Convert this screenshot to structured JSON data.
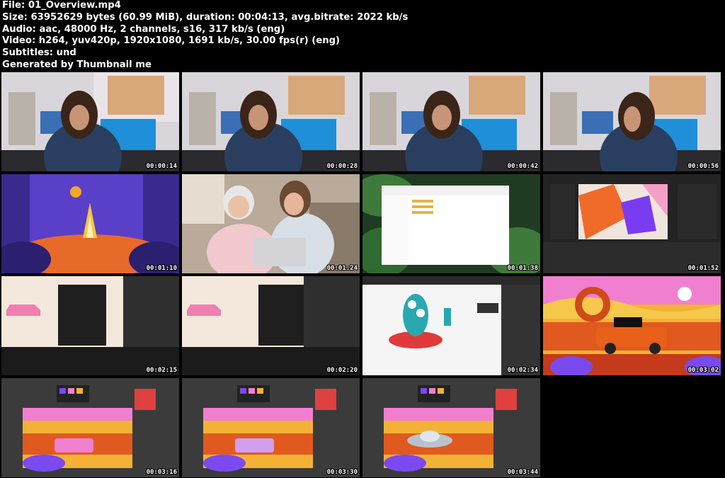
{
  "header": {
    "file": "File: 01_Overview.mp4",
    "size": "Size: 63952629 bytes (60.99 MiB), duration: 00:04:13, avg.bitrate: 2022 kb/s",
    "audio": "Audio: aac, 48000 Hz, 2 channels, s16, 317 kb/s (eng)",
    "video": "Video: h264, yuv420p, 1920x1080, 1691 kb/s, 30.00 fps(r) (eng)",
    "subtitles": "Subtitles: und",
    "generated": "Generated by Thumbnail me"
  },
  "thumbnails": [
    {
      "time": "00:00:14",
      "scene": "presenter-video"
    },
    {
      "time": "00:00:28",
      "scene": "presenter-video"
    },
    {
      "time": "00:00:42",
      "scene": "presenter-video"
    },
    {
      "time": "00:00:56",
      "scene": "presenter-video"
    },
    {
      "time": "00:01:10",
      "scene": "campfire-illustration"
    },
    {
      "time": "00:01:24",
      "scene": "people-laptop"
    },
    {
      "time": "00:01:38",
      "scene": "file-explorer"
    },
    {
      "time": "00:01:52",
      "scene": "after-effects-geometric"
    },
    {
      "time": "00:02:15",
      "scene": "after-effects-car"
    },
    {
      "time": "00:02:20",
      "scene": "after-effects-car"
    },
    {
      "time": "00:02:34",
      "scene": "monster-character"
    },
    {
      "time": "00:03:02",
      "scene": "car-desert-illustration"
    },
    {
      "time": "00:03:16",
      "scene": "photoshop-car"
    },
    {
      "time": "00:03:30",
      "scene": "photoshop-car"
    },
    {
      "time": "00:03:44",
      "scene": "photoshop-ufo"
    }
  ]
}
